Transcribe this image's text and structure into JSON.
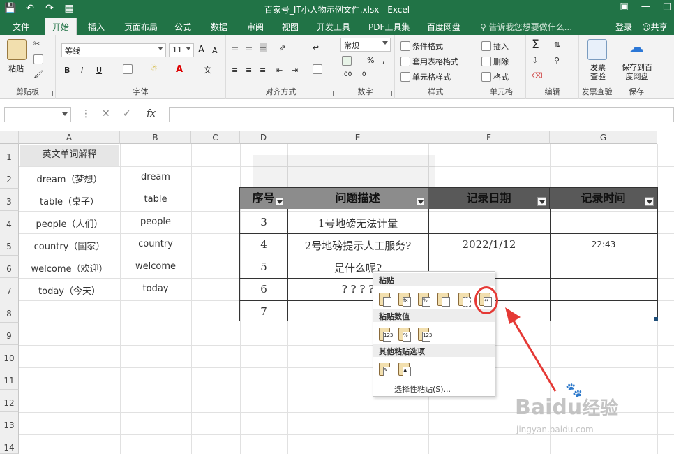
{
  "window": {
    "title": "百家号_IT小人物示例文件.xlsx - Excel"
  },
  "tabs": [
    "文件",
    "开始",
    "插入",
    "页面布局",
    "公式",
    "数据",
    "审阅",
    "视图",
    "开发工具",
    "PDF工具集",
    "百度网盘"
  ],
  "active_tab": "开始",
  "tellme": "告诉我您想要做什么...",
  "login": "登录",
  "share": "共享",
  "ribbon": {
    "clipboard": {
      "label": "剪贴板",
      "paste": "粘贴"
    },
    "font": {
      "label": "字体",
      "name": "等线",
      "size": "11",
      "bold": "B",
      "italic": "I",
      "underline": "U",
      "grow": "A",
      "shrink": "A",
      "fontcolor": "A"
    },
    "align": {
      "label": "对齐方式"
    },
    "number": {
      "label": "数字",
      "format": "常规",
      "percent": "%",
      "comma": ",",
      "inc": ".00",
      "dec": ".0"
    },
    "styles": {
      "label": "样式",
      "cond": "条件格式",
      "table": "套用表格格式",
      "cell": "单元格样式"
    },
    "cells": {
      "label": "单元格",
      "insert": "插入",
      "delete": "删除",
      "format": "格式"
    },
    "edit": {
      "label": "编辑",
      "sum": "Σ"
    },
    "invoice": {
      "label": "发票查验",
      "button": "发票查验"
    },
    "save": {
      "label": "保存",
      "button": "保存到百度网盘"
    }
  },
  "formula_bar": {
    "fx": "fx"
  },
  "columns": [
    "A",
    "B",
    "C",
    "D",
    "E",
    "F",
    "G"
  ],
  "rows": [
    "1",
    "2",
    "3",
    "4",
    "5",
    "6",
    "7",
    "8",
    "9",
    "10",
    "11",
    "12",
    "13",
    "14"
  ],
  "sheet_left": {
    "header": "英文单词解释",
    "col_a": [
      "dream（梦想）",
      "table（桌子）",
      "people（人们）",
      "country（国家）",
      "welcome（欢迎）",
      "today（今天）"
    ],
    "col_b": [
      "dream",
      "table",
      "people",
      "country",
      "welcome",
      "today"
    ]
  },
  "table": {
    "headers": [
      "序号",
      "问题描述",
      "记录日期",
      "记录时间"
    ],
    "rows": [
      {
        "no": "3",
        "desc": "1号地磅无法计量",
        "date": "",
        "time": ""
      },
      {
        "no": "4",
        "desc": "2号地磅提示人工服务?",
        "date": "2022/1/12",
        "time": "22:43"
      },
      {
        "no": "5",
        "desc": "是什么呢?",
        "date": "",
        "time": ""
      },
      {
        "no": "6",
        "desc": "? ? ? ?",
        "date": "",
        "time": ""
      },
      {
        "no": "7",
        "desc": "",
        "date": "",
        "time": ""
      }
    ]
  },
  "paste_menu": {
    "paste_header": "粘贴",
    "values_header": "粘贴数值",
    "other_header": "其他粘贴选项",
    "special": "选择性粘贴(S)...",
    "paste_icons": [
      "paste-icon",
      "paste-formula-icon",
      "paste-formula-number-icon",
      "paste-keep-format-icon",
      "paste-no-border-icon",
      "paste-keep-width-icon"
    ],
    "value_icons": [
      "paste-values-icon",
      "paste-values-number-icon",
      "paste-values-source-icon"
    ],
    "other_icons": [
      "paste-format-icon",
      "paste-picture-icon"
    ]
  },
  "watermark": {
    "logo": "Bai",
    "logo2": "du",
    "cn": "经验",
    "url": "jingyan.baidu.com"
  },
  "colors": {
    "excel_green": "#217346",
    "header_gray": "#595959",
    "highlight": "#e53935"
  }
}
